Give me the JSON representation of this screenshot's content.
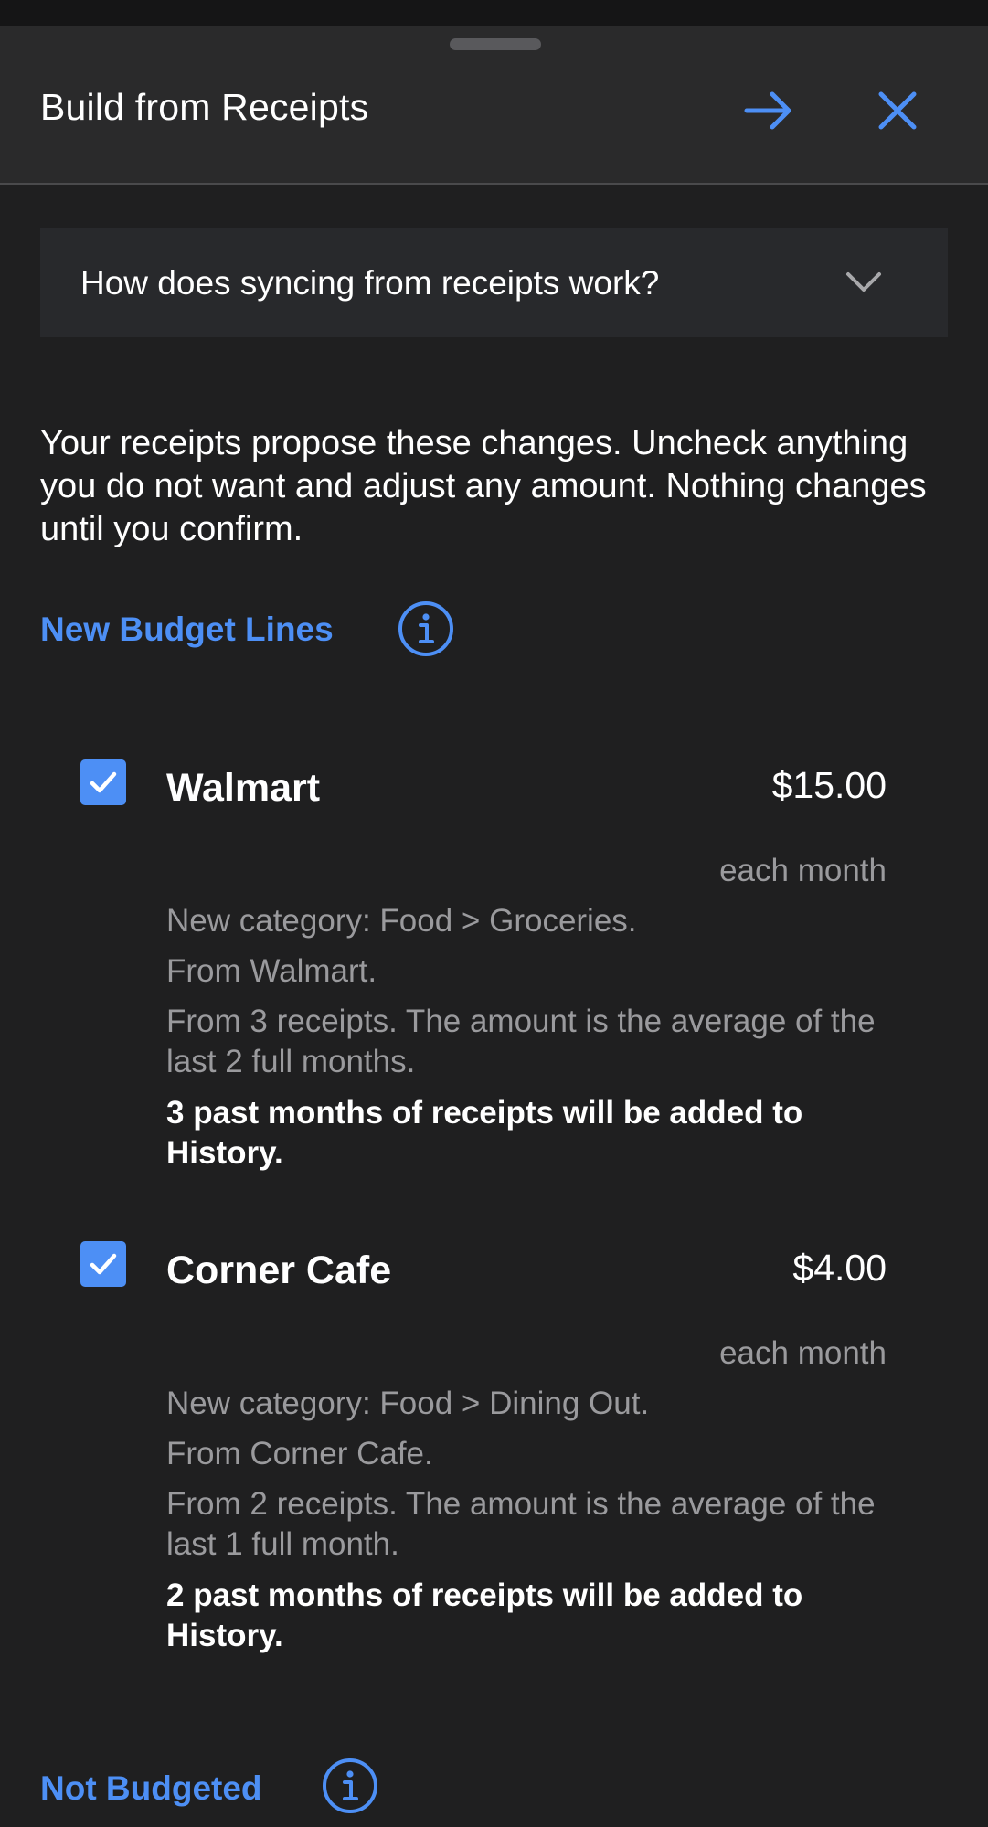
{
  "header": {
    "title": "Build from Receipts",
    "next_icon": "arrow-right-icon",
    "close_icon": "close-icon",
    "accent": "#4d8ff5"
  },
  "faq": {
    "question": "How does syncing from receipts work?",
    "icon": "chevron-down-icon"
  },
  "intro": "Your receipts propose these changes. Uncheck anything you do not want and adjust any amount. Nothing changes until you confirm.",
  "sections": {
    "new_budget_lines": {
      "title": "New Budget Lines",
      "icon": "info-icon",
      "items": [
        {
          "checked": true,
          "name": "Walmart",
          "amount": "$15.00",
          "frequency": "each month",
          "category": "New category: Food > Groceries.",
          "source": "From Walmart.",
          "basis": "From 3 receipts. The amount is the average of the last 2 full months.",
          "history_note": "3 past months of receipts will be added to History."
        },
        {
          "checked": true,
          "name": "Corner Cafe",
          "amount": "$4.00",
          "frequency": "each month",
          "category": "New category: Food > Dining Out.",
          "source": "From Corner Cafe.",
          "basis": "From 2 receipts. The amount is the average of the last 1 full month.",
          "history_note": "2 past months of receipts will be added to History."
        }
      ]
    },
    "not_budgeted": {
      "title": "Not Budgeted",
      "icon": "info-icon"
    }
  }
}
